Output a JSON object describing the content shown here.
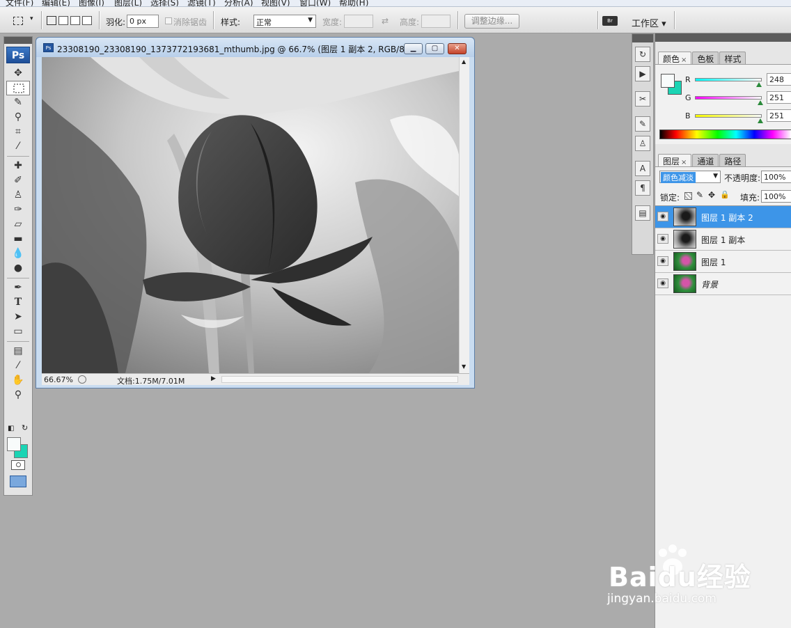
{
  "menu": [
    "文件(F)",
    "编辑(E)",
    "图像(I)",
    "图层(L)",
    "选择(S)",
    "滤镜(T)",
    "分析(A)",
    "视图(V)",
    "窗口(W)",
    "帮助(H)"
  ],
  "options": {
    "feather_label": "羽化:",
    "feather_value": "0 px",
    "antialias_label": "消除锯齿",
    "style_label": "样式:",
    "style_value": "正常",
    "width_label": "宽度:",
    "height_label": "高度:",
    "refine_edge_button": "调整边缘...",
    "workspace_label": "工作区 ▾"
  },
  "toolbox": {
    "logo": "Ps"
  },
  "document": {
    "title": "23308190_23308190_1373772193681_mthumb.jpg @ 66.7% (图层 1 副本 2, RGB/8*)",
    "zoom": "66.67%",
    "doc_size": "文档:1.75M/7.01M"
  },
  "color_panel": {
    "tabs": [
      "颜色",
      "色板",
      "样式"
    ],
    "channels": [
      {
        "name": "R",
        "value": "248"
      },
      {
        "name": "G",
        "value": "251"
      },
      {
        "name": "B",
        "value": "251"
      }
    ],
    "foreground_color": "#f8fbfb",
    "background_color": "#1bd4b4"
  },
  "layers_panel": {
    "tabs": [
      "图层",
      "通道",
      "路径"
    ],
    "blend_mode": "颜色减淡",
    "opacity_label": "不透明度:",
    "opacity_value": "100%",
    "lock_label": "锁定:",
    "fill_label": "填充:",
    "fill_value": "100%",
    "layers": [
      {
        "name": "图层 1 副本 2",
        "selected": true,
        "thumb": "grayscale"
      },
      {
        "name": "图层 1 副本",
        "selected": false,
        "thumb": "grayscale"
      },
      {
        "name": "图层 1",
        "selected": false,
        "thumb": "color"
      },
      {
        "name": "背景",
        "selected": false,
        "thumb": "color"
      }
    ]
  },
  "watermark": {
    "brand": "Baidu经验",
    "url": "jingyan.baidu.com"
  }
}
